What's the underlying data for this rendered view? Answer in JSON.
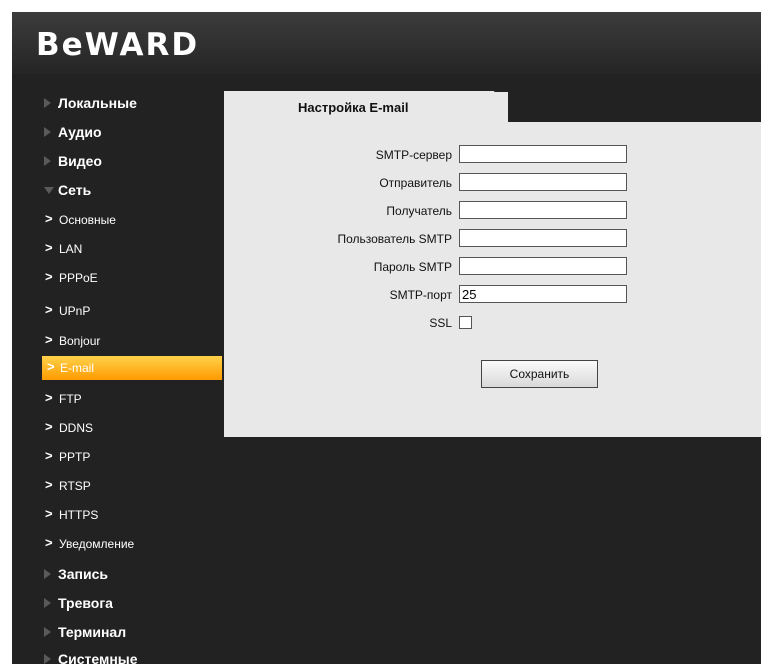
{
  "brand": {
    "logo_text": "BeWARD"
  },
  "sidebar": {
    "categories_top": [
      {
        "label": "Локальные"
      },
      {
        "label": "Аудио"
      },
      {
        "label": "Видео"
      },
      {
        "label": "Сеть"
      }
    ],
    "network_items": [
      {
        "label": "Основные"
      },
      {
        "label": "LAN"
      },
      {
        "label": "PPPoE"
      },
      {
        "label": "UPnP"
      },
      {
        "label": "Bonjour"
      },
      {
        "label": "E-mail"
      },
      {
        "label": "FTP"
      },
      {
        "label": "DDNS"
      },
      {
        "label": "PPTP"
      },
      {
        "label": "RTSP"
      },
      {
        "label": "HTTPS"
      },
      {
        "label": "Уведомление"
      }
    ],
    "categories_bottom": [
      {
        "label": "Запись"
      },
      {
        "label": "Тревога"
      },
      {
        "label": "Терминал"
      },
      {
        "label": "Системные"
      }
    ],
    "active_item": "E-mail",
    "chevron_glyph": ">"
  },
  "email_settings": {
    "tab_title": "Настройка E-mail",
    "fields": {
      "smtp_server": {
        "label": "SMTP-сервер",
        "value": ""
      },
      "sender": {
        "label": "Отправитель",
        "value": ""
      },
      "recipient": {
        "label": "Получатель",
        "value": ""
      },
      "smtp_user": {
        "label": "Пользователь SMTP",
        "value": ""
      },
      "smtp_password": {
        "label": "Пароль SMTP",
        "value": ""
      },
      "smtp_port": {
        "label": "SMTP-порт",
        "value": "25"
      },
      "ssl": {
        "label": "SSL",
        "checked": false
      }
    },
    "save_label": "Сохранить"
  },
  "colors": {
    "header_bg": "#2f2f2f",
    "panel_bg": "#222222",
    "content_bg": "#e8e8e8",
    "active_gradient_top": "#ffd24a",
    "active_gradient_bottom": "#ff9a00"
  }
}
